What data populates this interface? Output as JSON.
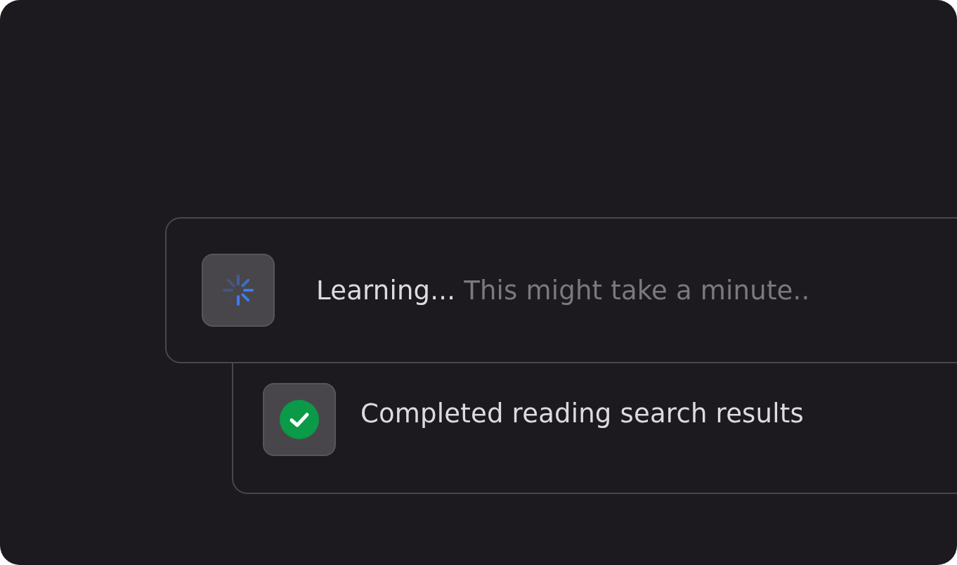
{
  "steps": [
    {
      "kind": "loading",
      "title": "Learning...",
      "detail": "This might take a minute.."
    },
    {
      "kind": "done",
      "title": "Completed reading search results"
    }
  ]
}
